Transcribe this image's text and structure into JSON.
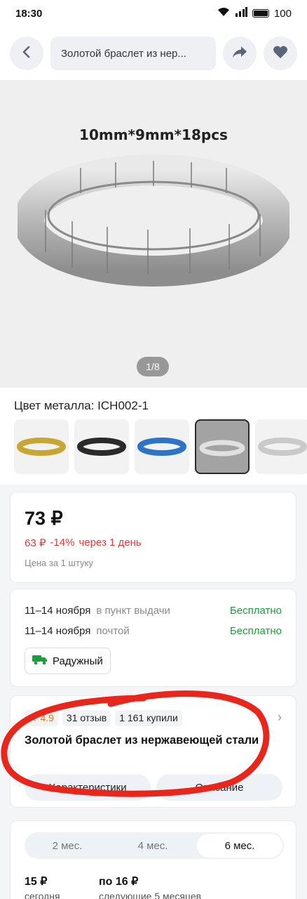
{
  "status": {
    "time": "18:30",
    "battery": "100"
  },
  "header": {
    "search_text": "Золотой браслет из нер..."
  },
  "gallery": {
    "caption": "10mm*9mm*18pcs",
    "counter": "1/8"
  },
  "variant": {
    "label": "Цвет металла: ICH002-1",
    "options": [
      "gold",
      "black",
      "blue",
      "silver-selected",
      "silver"
    ]
  },
  "price": {
    "main": "73 ₽",
    "old": "63 ₽",
    "discount": "-14%",
    "when": "через 1 день",
    "note": "Цена за 1 штуку"
  },
  "delivery": {
    "rows": [
      {
        "date": "11–14 ноября",
        "method": "в пункт выдачи",
        "cost": "Бесплатно"
      },
      {
        "date": "11–14 ноября",
        "method": "почтой",
        "cost": "Бесплатно"
      }
    ],
    "pickup": "Радужный"
  },
  "product": {
    "rating": "4.9",
    "reviews": "31 отзыв",
    "bought": "1 161 купили",
    "title": "Золотой браслет из нержавеющей стали",
    "pill_chars": "Характеристики",
    "pill_desc": "Описание"
  },
  "installments": {
    "tabs": [
      "2 мес.",
      "4 мес.",
      "6 мес."
    ],
    "plan_today_amount": "15 ₽",
    "plan_today_label": "сегодня",
    "plan_next_amount": "по 16 ₽",
    "plan_next_label": "следующие 5 месяцев"
  },
  "colors": {
    "green": "#1b9e3a",
    "red": "#e23b3b",
    "orange": "#e07a16",
    "annotation": "#e8261c"
  }
}
